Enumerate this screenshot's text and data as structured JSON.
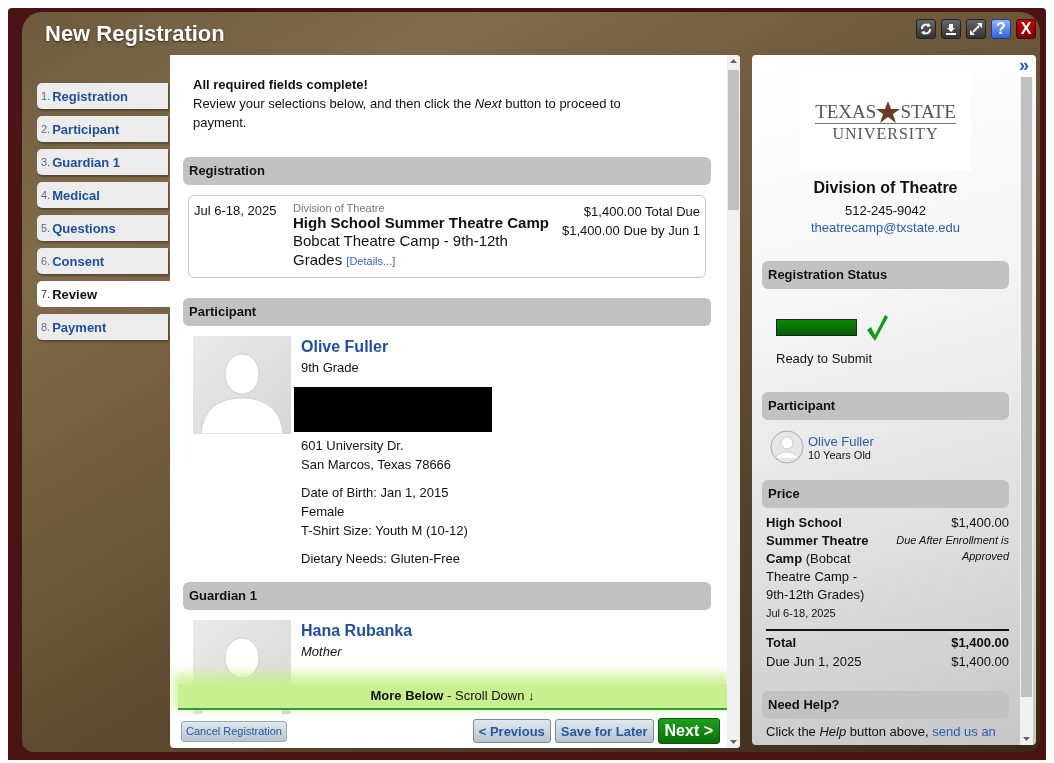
{
  "window": {
    "title": "New Registration",
    "buttons": [
      {
        "kind": "refresh"
      },
      {
        "kind": "download"
      },
      {
        "kind": "resize"
      },
      {
        "kind": "help",
        "glyph": "?"
      },
      {
        "kind": "close",
        "glyph": "X"
      }
    ]
  },
  "steps": [
    {
      "number": "1.",
      "label": "Registration",
      "selected": false
    },
    {
      "number": "2.",
      "label": "Participant",
      "selected": false
    },
    {
      "number": "3.",
      "label": "Guardian 1",
      "selected": false
    },
    {
      "number": "4.",
      "label": "Medical",
      "selected": false
    },
    {
      "number": "5.",
      "label": "Questions",
      "selected": false
    },
    {
      "number": "6.",
      "label": "Consent",
      "selected": false
    },
    {
      "number": "7.",
      "label": "Review",
      "selected": true
    },
    {
      "number": "8.",
      "label": "Payment",
      "selected": false
    }
  ],
  "review": {
    "heading": "All required fields complete!",
    "intro": "Review your selections below, and then click the *Next* button to proceed to payment.",
    "registration": {
      "header": "Registration",
      "dates": "Jul 6-18, 2025",
      "organizer": "Division of Theatre",
      "program": "High School Summer Theatre Camp",
      "session": "Bobcat Theatre Camp - 9th-12th Grades",
      "details_link": "[Details...]",
      "total_due": "$1,400.00 Total Due",
      "due_by": "$1,400.00 Due by Jun 1"
    },
    "participant": {
      "header": "Participant",
      "name": "Olive Fuller",
      "grade": "9th Grade",
      "redacted": true,
      "address": [
        "601 University Dr.",
        "San Marcos, Texas 78666"
      ],
      "details": [
        "Date of Birth: Jan 1, 2015",
        "Female",
        "T-Shirt Size: Youth M (10-12)"
      ],
      "dietary": "Dietary Needs: Gluten-Free"
    },
    "guardian": {
      "header": "Guardian 1",
      "name": "Hana Rubanka",
      "relation": "Mother"
    },
    "more_below": "**More Below** - Scroll Down ↓",
    "buttons": [
      {
        "kind": "cancel",
        "label": "Cancel Registration"
      },
      {
        "kind": "previous",
        "label": "< Previous"
      },
      {
        "kind": "save",
        "label": "Save for Later"
      },
      {
        "kind": "next",
        "label": "Next >"
      }
    ]
  },
  "sidebar": {
    "collapse": "»",
    "logo": {
      "left": "TEXAS",
      "right": "STATE",
      "bottom": "UNIVERSITY"
    },
    "organization": "Division of Theatre",
    "phone": "512-245-9042",
    "email": "theatrecamp@txstate.edu",
    "status": {
      "header": "Registration Status",
      "level": 1,
      "complete": true,
      "label": "Ready to Submit"
    },
    "participant": {
      "header": "Participant",
      "name": "Olive Fuller",
      "age": "10 Years Old"
    },
    "price": {
      "header": "Price",
      "item": "**High School Summer Theatre Camp** (Bobcat Theatre Camp - 9th-12th Grades)",
      "dates": "Jul 6-18, 2025",
      "amount": "$1,400.00",
      "note": "Due After Enrollment is Approved",
      "total_label": "Total",
      "total": "$1,400.00",
      "due_label": "Due Jun 1, 2025",
      "due_amount": "$1,400.00"
    },
    "help": {
      "header": "Need Help?",
      "text": "Click the *Help* button above,",
      "link": "send us an"
    }
  }
}
